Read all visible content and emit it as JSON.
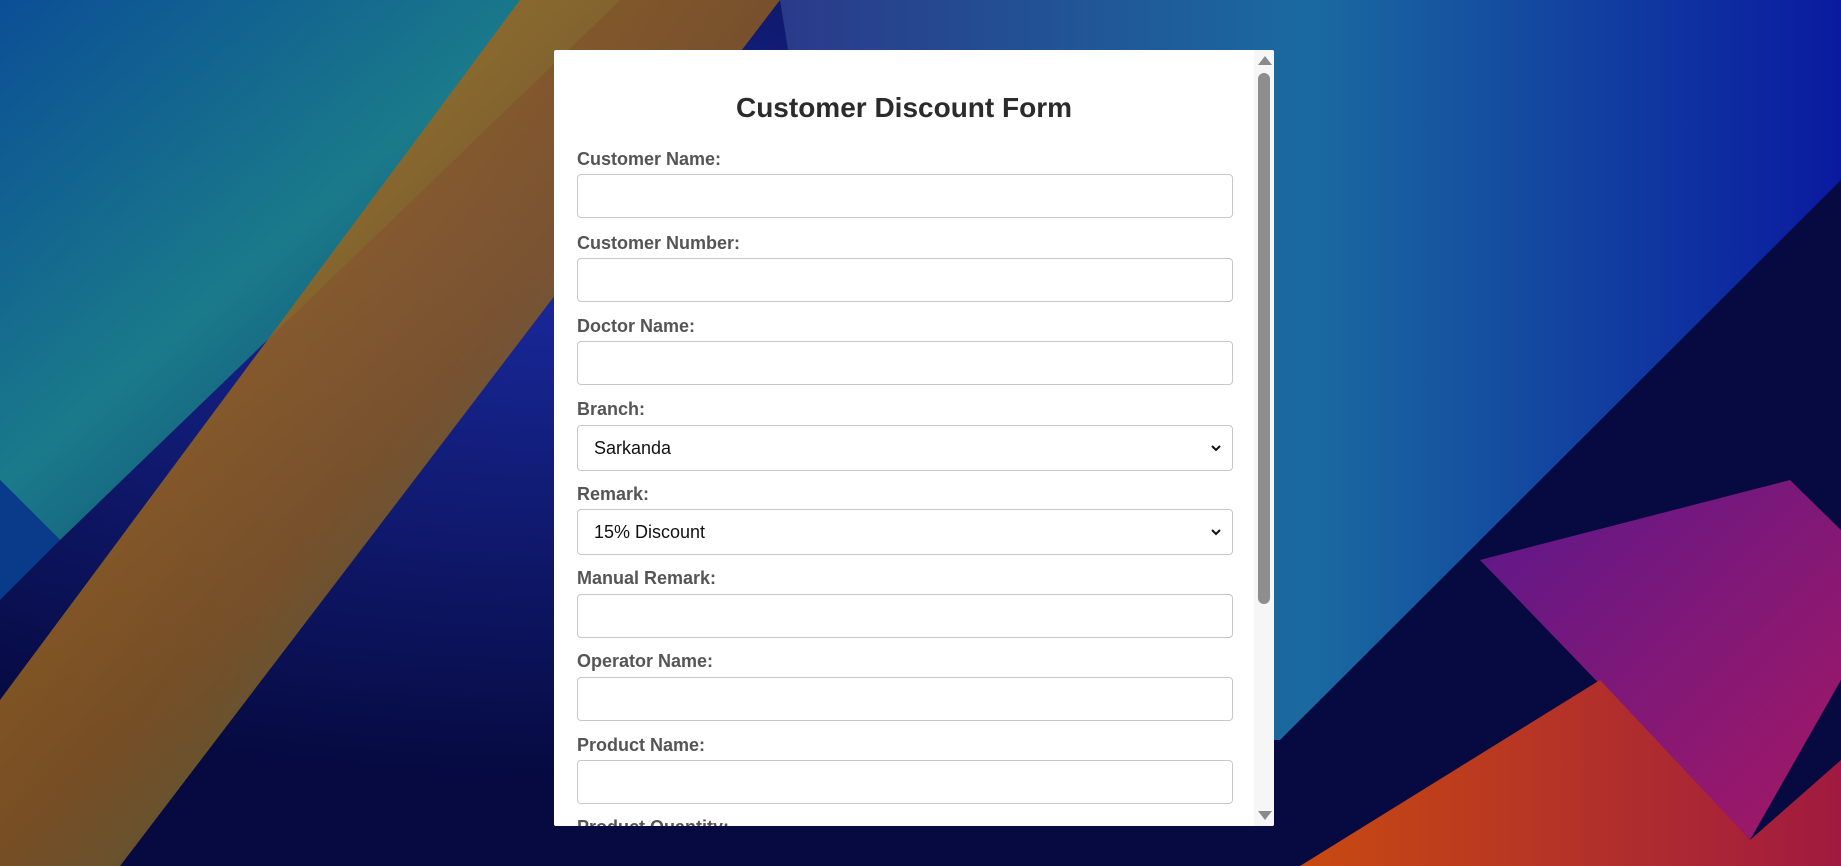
{
  "form": {
    "title": "Customer Discount Form",
    "fields": {
      "customer_name": {
        "label": "Customer Name:",
        "value": ""
      },
      "customer_number": {
        "label": "Customer Number:",
        "value": ""
      },
      "doctor_name": {
        "label": "Doctor Name:",
        "value": ""
      },
      "branch": {
        "label": "Branch:",
        "selected": "Sarkanda"
      },
      "remark": {
        "label": "Remark:",
        "selected": "15% Discount"
      },
      "manual_remark": {
        "label": "Manual Remark:",
        "value": ""
      },
      "operator_name": {
        "label": "Operator Name:",
        "value": ""
      },
      "product_name": {
        "label": "Product Name:",
        "value": ""
      },
      "product_quantity": {
        "label": "Product Quantity:"
      }
    }
  },
  "colors": {
    "card_background": "#ffffff",
    "label_text": "#555555",
    "title_text": "#2b2b2b",
    "input_border": "#c8c8c8",
    "scrollbar_thumb": "#8e8e8e"
  },
  "icons": {
    "select_chevron": "chevron-down-icon",
    "scroll_up": "arrow-up-icon",
    "scroll_down": "arrow-down-icon"
  },
  "scroll": {
    "visible_fraction": 0.72,
    "position_fraction": 0.0
  }
}
